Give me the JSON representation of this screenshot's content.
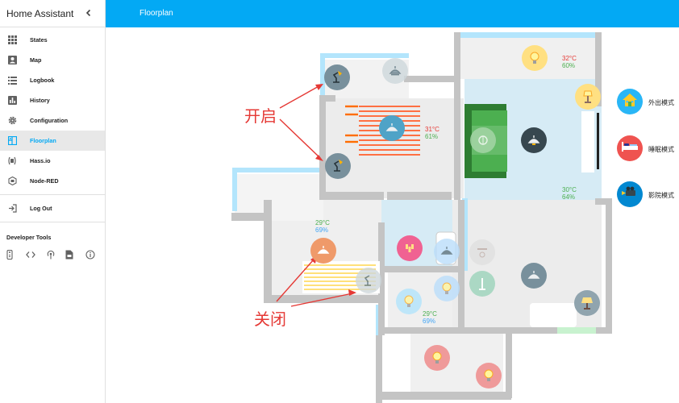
{
  "sidebar": {
    "title": "Home Assistant",
    "items": [
      {
        "label": "States",
        "icon": "grid-icon"
      },
      {
        "label": "Map",
        "icon": "account-box-icon"
      },
      {
        "label": "Logbook",
        "icon": "list-icon"
      },
      {
        "label": "History",
        "icon": "chart-icon"
      },
      {
        "label": "Configuration",
        "icon": "gear-icon"
      },
      {
        "label": "Floorplan",
        "icon": "floorplan-icon",
        "active": true
      },
      {
        "label": "Hass.io",
        "icon": "hassio-icon"
      },
      {
        "label": "Node-RED",
        "icon": "node-red-icon"
      },
      {
        "label": "Log Out",
        "icon": "logout-icon"
      }
    ],
    "developer_tools": {
      "title": "Developer Tools",
      "icons": [
        "remote-icon",
        "code-icon",
        "antenna-icon",
        "file-icon",
        "info-icon"
      ]
    }
  },
  "header": {
    "title": "Floorplan"
  },
  "floorplan": {
    "readings": [
      {
        "temp": "32°C",
        "humidity": "60%",
        "temp_color": "#e53935",
        "hum_color": "#4caf50"
      },
      {
        "temp": "31°C",
        "humidity": "61%",
        "temp_color": "#e53935",
        "hum_color": "#4caf50"
      },
      {
        "temp": "30°C",
        "humidity": "64%",
        "temp_color": "#4caf50",
        "hum_color": "#4caf50"
      },
      {
        "temp": "29°C",
        "humidity": "69%",
        "temp_color": "#4caf50",
        "hum_color": "#42a5f5"
      },
      {
        "temp": "29°C",
        "humidity": "69%",
        "temp_color": "#4caf50",
        "hum_color": "#42a5f5"
      }
    ],
    "modes": [
      {
        "label": "外出模式",
        "icon": "home-icon",
        "color": "#29b6f6"
      },
      {
        "label": "睡眠模式",
        "icon": "bed-icon",
        "color": "#ef5350"
      },
      {
        "label": "影院模式",
        "icon": "projector-icon",
        "color": "#0288d1"
      }
    ],
    "annotations": {
      "on": "开启",
      "off": "关闭"
    }
  }
}
